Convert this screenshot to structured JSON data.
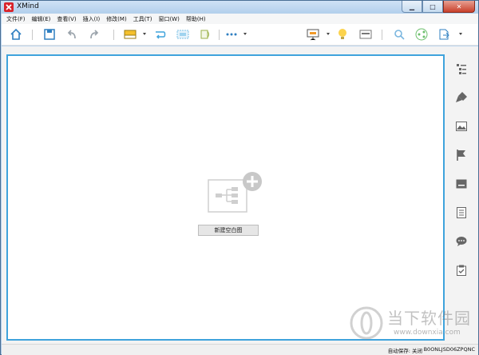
{
  "window": {
    "title": "XMind"
  },
  "menu": {
    "items": [
      "文件(F)",
      "编辑(E)",
      "查看(V)",
      "插入(I)",
      "修改(M)",
      "工具(T)",
      "窗口(W)",
      "帮助(H)"
    ]
  },
  "toolbar": {
    "icons": [
      "home-icon",
      "save-icon",
      "undo-icon",
      "redo-icon",
      "topic-icon",
      "relationship-icon",
      "boundary-icon",
      "summary-icon",
      "more-icon",
      "presentation-icon",
      "lightbulb-icon",
      "layout-icon",
      "search-icon",
      "share-icon",
      "export-icon"
    ]
  },
  "canvas": {
    "new_blank_label": "新建空白图"
  },
  "sidebar": {
    "icons": [
      "outline-icon",
      "format-brush-icon",
      "image-icon",
      "marker-flag-icon",
      "label-icon",
      "notes-icon",
      "comment-icon",
      "task-icon"
    ]
  },
  "watermark": {
    "main": "当下软件园",
    "sub": "www.downxia.com"
  },
  "status": {
    "autosave": "自动保存: 关闭",
    "code": "B0ONLJSD06ZPQNC"
  },
  "colors": {
    "accent": "#3fa3dc",
    "logo": "#d9242b"
  }
}
